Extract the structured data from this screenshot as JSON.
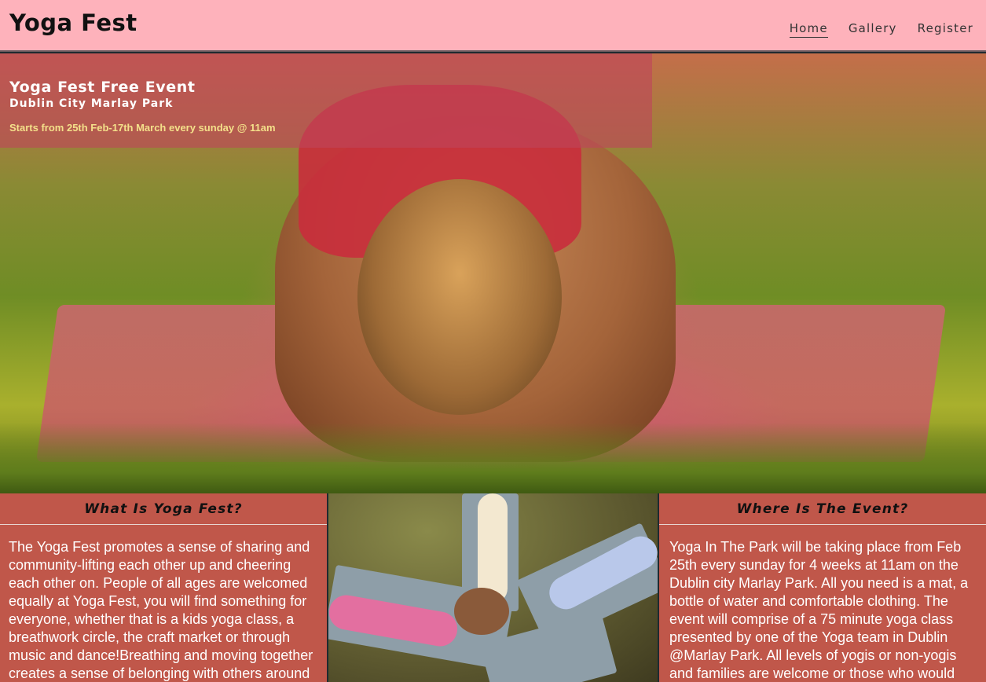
{
  "header": {
    "brand": "Yoga Fest",
    "nav": [
      {
        "label": "Home",
        "active": true
      },
      {
        "label": "Gallery",
        "active": false
      },
      {
        "label": "Register",
        "active": false
      }
    ]
  },
  "hero": {
    "title": "Yoga Fest Free Event",
    "subtitle": "Dublin City Marlay Park",
    "dates": "Starts from 25th Feb-17th March every sunday @ 11am"
  },
  "sections": {
    "what": {
      "heading": "What Is Yoga Fest?",
      "body": "The Yoga Fest promotes a sense of sharing and community-lifting each other up and cheering each other on. People of all ages are welcomed equally at Yoga Fest, you will find something for everyone, whether that is a kids yoga class, a breathwork circle, the craft market or through music and dance!Breathing and moving together creates a sense of belonging with others around"
    },
    "where": {
      "heading": "Where Is The Event?",
      "body": "Yoga In The Park will be taking place from Feb 25th every sunday for 4 weeks at 11am on the Dublin city Marlay Park. All you need is a mat, a bottle of water and comfortable clothing. The event will comprise of a 75 minute yoga class presented by one of the Yoga team in Dublin @Marlay Park. All levels of yogis or non-yogis and families are welcome or those who would"
    }
  },
  "colors": {
    "header_bg": "#feb2bb",
    "section_bg": "#c0574a",
    "banner_overlay": "#be465a",
    "dates_text": "#f4e08a"
  }
}
